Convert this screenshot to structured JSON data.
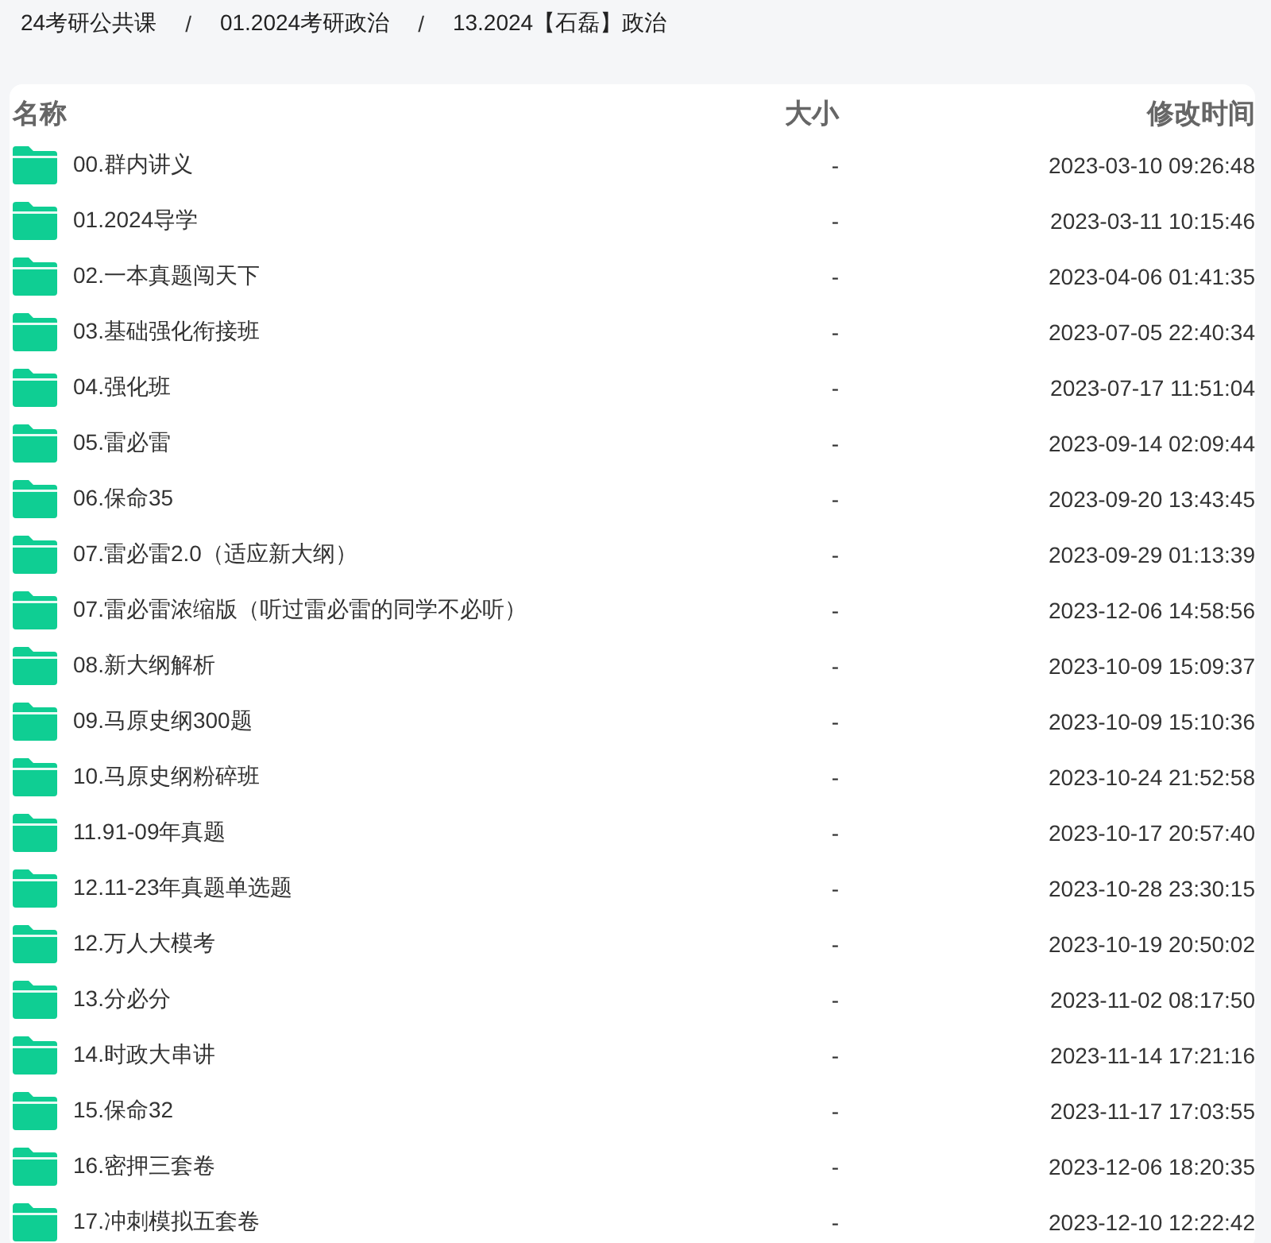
{
  "breadcrumb": [
    {
      "kind": "link",
      "text": "24考研公共课"
    },
    {
      "kind": "separator",
      "text": "/"
    },
    {
      "kind": "link",
      "text": "01.2024考研政治"
    },
    {
      "kind": "separator",
      "text": "/"
    },
    {
      "kind": "link",
      "text": "13.2024【石磊】政治"
    }
  ],
  "table": {
    "columns": [
      "名称",
      "大小",
      "修改时间"
    ],
    "rows": [
      {
        "name": "00.群内讲义",
        "size": "-",
        "modified": "2023-03-10 09:26:48"
      },
      {
        "name": "01.2024导学",
        "size": "-",
        "modified": "2023-03-11 10:15:46"
      },
      {
        "name": "02.一本真题闯天下",
        "size": "-",
        "modified": "2023-04-06 01:41:35"
      },
      {
        "name": "03.基础强化衔接班",
        "size": "-",
        "modified": "2023-07-05 22:40:34"
      },
      {
        "name": "04.强化班",
        "size": "-",
        "modified": "2023-07-17 11:51:04"
      },
      {
        "name": "05.雷必雷",
        "size": "-",
        "modified": "2023-09-14 02:09:44"
      },
      {
        "name": "06.保命35",
        "size": "-",
        "modified": "2023-09-20 13:43:45"
      },
      {
        "name": "07.雷必雷2.0（适应新大纲）",
        "size": "-",
        "modified": "2023-09-29 01:13:39"
      },
      {
        "name": "07.雷必雷浓缩版（听过雷必雷的同学不必听）",
        "size": "-",
        "modified": "2023-12-06 14:58:56"
      },
      {
        "name": "08.新大纲解析",
        "size": "-",
        "modified": "2023-10-09 15:09:37"
      },
      {
        "name": "09.马原史纲300题",
        "size": "-",
        "modified": "2023-10-09 15:10:36"
      },
      {
        "name": "10.马原史纲粉碎班",
        "size": "-",
        "modified": "2023-10-24 21:52:58"
      },
      {
        "name": "11.91-09年真题",
        "size": "-",
        "modified": "2023-10-17 20:57:40"
      },
      {
        "name": "12.11-23年真题单选题",
        "size": "-",
        "modified": "2023-10-28 23:30:15"
      },
      {
        "name": "12.万人大模考",
        "size": "-",
        "modified": "2023-10-19 20:50:02"
      },
      {
        "name": "13.分必分",
        "size": "-",
        "modified": "2023-11-02 08:17:50"
      },
      {
        "name": "14.时政大串讲",
        "size": "-",
        "modified": "2023-11-14 17:21:16"
      },
      {
        "name": "15.保命32",
        "size": "-",
        "modified": "2023-11-17 17:03:55"
      },
      {
        "name": "16.密押三套卷",
        "size": "-",
        "modified": "2023-12-06 18:20:35"
      },
      {
        "name": "17.冲刺模拟五套卷",
        "size": "-",
        "modified": "2023-12-10 12:22:42"
      }
    ]
  }
}
